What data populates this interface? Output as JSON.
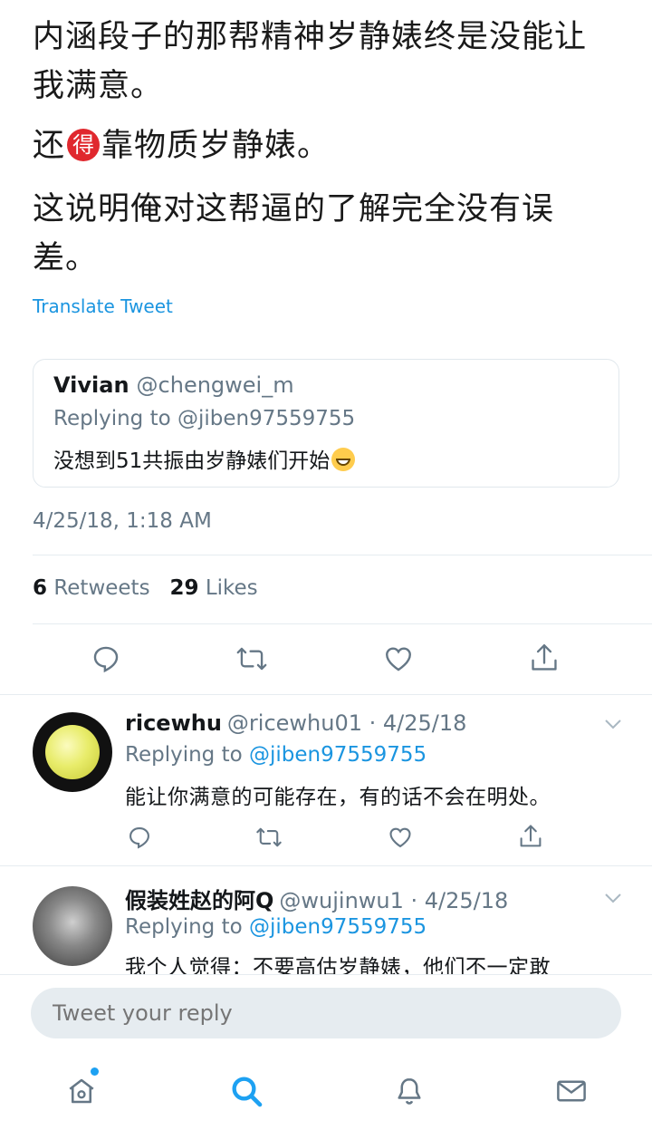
{
  "tweet": {
    "lines": [
      "内涵段子的那帮精神岁静婊终是没能让",
      "我满意。",
      "还",
      "靠物质岁静婊。",
      "这说明俺对这帮逼的了解完全没有误",
      "差。"
    ],
    "de_badge": "得",
    "translate_label": "Translate Tweet",
    "timestamp": "4/25/18, 1:18 AM",
    "retweet_count": "6",
    "retweet_label": "Retweets",
    "like_count": "29",
    "like_label": "Likes"
  },
  "quoted": {
    "name": "Vivian",
    "handle": "@chengwei_m",
    "replying": "Replying to @jiben97559755",
    "text": "没想到51共振由岁静婊们开始"
  },
  "replies": [
    {
      "name": "ricewhu",
      "handle_date": "@ricewhu01 · 4/25/18",
      "replying_prefix": "Replying to",
      "mention": "@jiben97559755",
      "text": "能让你满意的可能存在，有的话不会在明处。"
    },
    {
      "name": "假装姓赵的阿Q",
      "handle_date": "@wujinwu1 · 4/25/18",
      "replying_prefix": "Replying to",
      "mention": "@jiben97559755",
      "text": "我个人觉得：不要高估岁静婊，他们不一定敢"
    }
  ],
  "composer": {
    "placeholder": "Tweet your reply"
  },
  "icons": {
    "reply": "reply-icon",
    "retweet": "retweet-icon",
    "like": "heart-icon",
    "share": "share-icon",
    "home": "home-icon",
    "search": "search-icon",
    "notifications": "bell-icon",
    "messages": "mail-icon"
  },
  "colors": {
    "accent": "#1da1f2",
    "link": "#1b95e0",
    "muted": "#657786",
    "badge": "#e0282e"
  }
}
